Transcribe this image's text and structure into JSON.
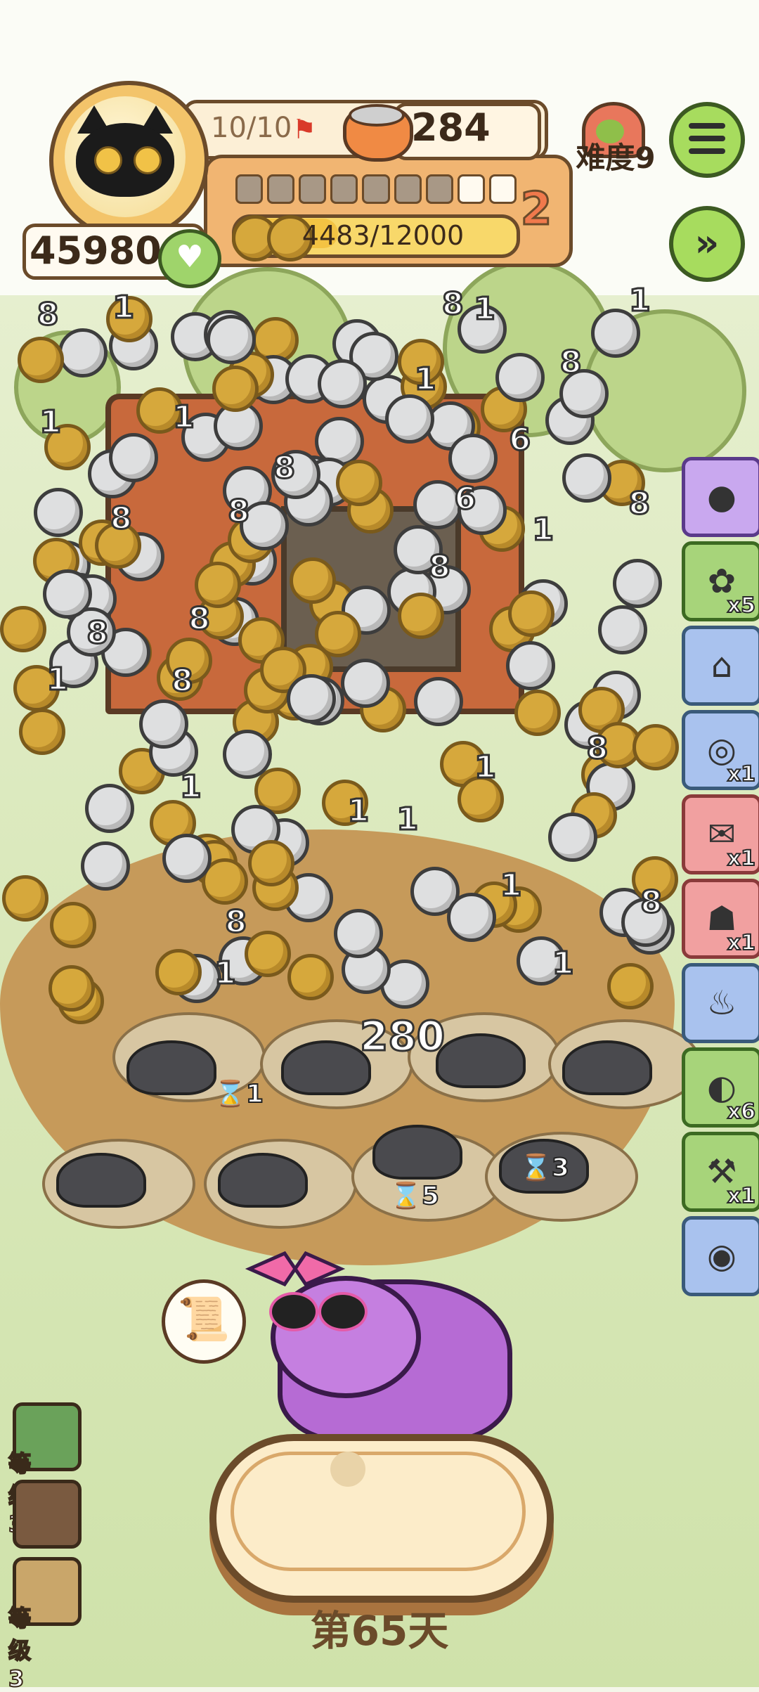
{
  "hud": {
    "score": "45980",
    "energy": "10/10",
    "coins": "284",
    "xp_text": "4483/12000",
    "xp_fraction": 0.374,
    "segments_total": 9,
    "segments_filled": 7,
    "level_badge": "2",
    "difficulty": "难度9"
  },
  "board": {
    "big_number": "280",
    "floating_numbers": [
      "1",
      "8",
      "8",
      "1",
      "1",
      "8",
      "1",
      "1",
      "8",
      "8",
      "1",
      "8",
      "8",
      "1",
      "1",
      "8",
      "8",
      "1",
      "8",
      "1",
      "1",
      "8",
      "1",
      "6",
      "1",
      "8",
      "8",
      "1",
      "8",
      "1",
      "6"
    ]
  },
  "timers": [
    "1",
    "5",
    "3"
  ],
  "right_slots": [
    {
      "name": "coin-pile-slot",
      "count": "",
      "color": "purple"
    },
    {
      "name": "paw-slot",
      "count": "x5",
      "color": "green"
    },
    {
      "name": "hut-slot",
      "count": "",
      "color": "blue"
    },
    {
      "name": "collar-slot",
      "count": "x1",
      "color": "blue"
    },
    {
      "name": "scroll-slot",
      "count": "x1",
      "color": "red"
    },
    {
      "name": "bag-slot",
      "count": "x1",
      "color": "red"
    },
    {
      "name": "grinder-slot",
      "count": "",
      "color": "blue"
    },
    {
      "name": "bowl-slot",
      "count": "x6",
      "color": "green"
    },
    {
      "name": "crane-slot",
      "count": "x1",
      "color": "green"
    },
    {
      "name": "can-slot",
      "count": "",
      "color": "blue"
    }
  ],
  "left_perks": [
    {
      "label": "等级3"
    },
    {
      "label": ""
    },
    {
      "label": "等级3"
    }
  ],
  "day_label": "第65天"
}
